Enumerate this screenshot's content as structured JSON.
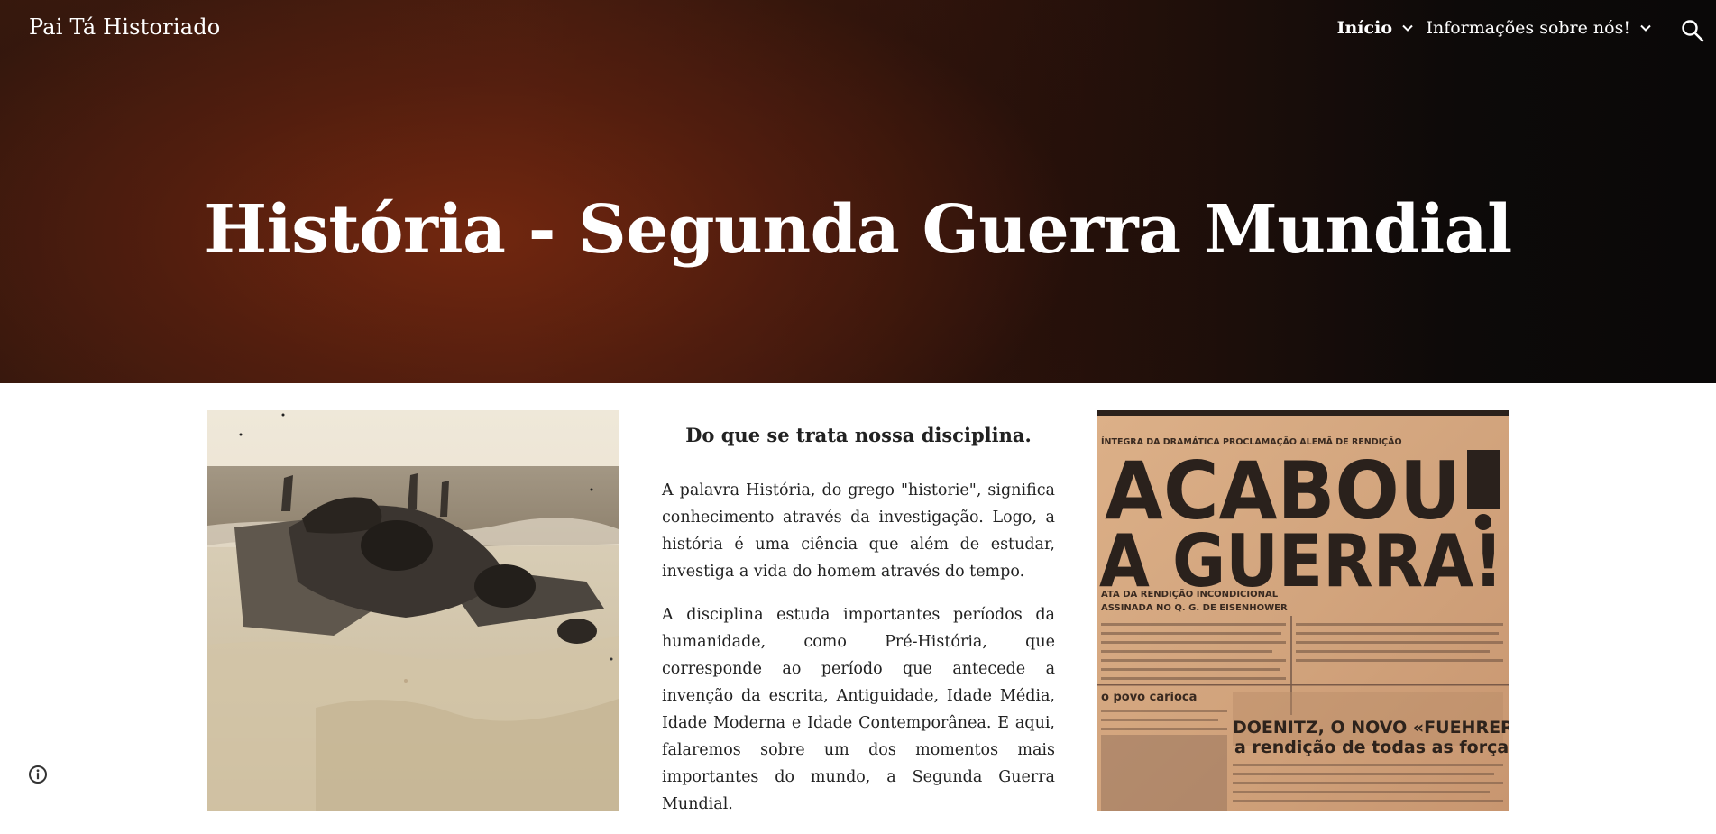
{
  "site": {
    "title": "Pai Tá Historiado"
  },
  "nav": {
    "items": [
      {
        "label": "Início",
        "active": true
      },
      {
        "label": "Informações sobre nós!",
        "active": false
      }
    ],
    "search_icon": "search-icon",
    "chevron_icon": "chevron-down-icon"
  },
  "hero": {
    "title": "História - Segunda Guerra Mundial"
  },
  "main": {
    "heading": "Do que se trata nossa disciplina.",
    "paragraphs": [
      "A palavra História, do grego \"historie\", significa conhecimento através da investigação. Logo, a história é uma ciência que além de estudar, investiga a vida do homem através do tempo.",
      "A disciplina estuda importantes períodos da humanidade, como Pré-História, que corresponde ao período que antecede a invenção da escrita, Antiguidade, Idade Média, Idade Moderna e Idade Contemporânea. E aqui, falaremos sobre um dos momentos mais importantes do mundo, a Segunda Guerra Mundial."
    ],
    "left_image": {
      "icon": "crashed-plane-photo"
    },
    "right_image": {
      "icon": "newspaper-photo",
      "headline_top": "ACABOU",
      "headline_bottom": "A GUERRA!",
      "masthead": "ÍNTEGRA DA DRAMÁTICA PROCLAMAÇÃO ALEMÃ DE RENDIÇÃO",
      "sub_lines": [
        "ATA DA RENDIÇÃO INCONDICIONAL",
        "ASSINADA NO Q. G. DE EISENHOWER"
      ],
      "side_line": "o povo carioca",
      "bottom_line_1": "DOENITZ, O NOVO «FUEHRER» ORDE",
      "bottom_line_2": "a rendição de todas as forças alem"
    }
  },
  "footer": {
    "info_icon": "info-icon"
  },
  "colors": {
    "hero_dark": "#0a0808",
    "hero_warm": "#4e2010",
    "text": "#222222",
    "sepia": "#cdbfa6",
    "newsprint": "#d9ab82"
  }
}
